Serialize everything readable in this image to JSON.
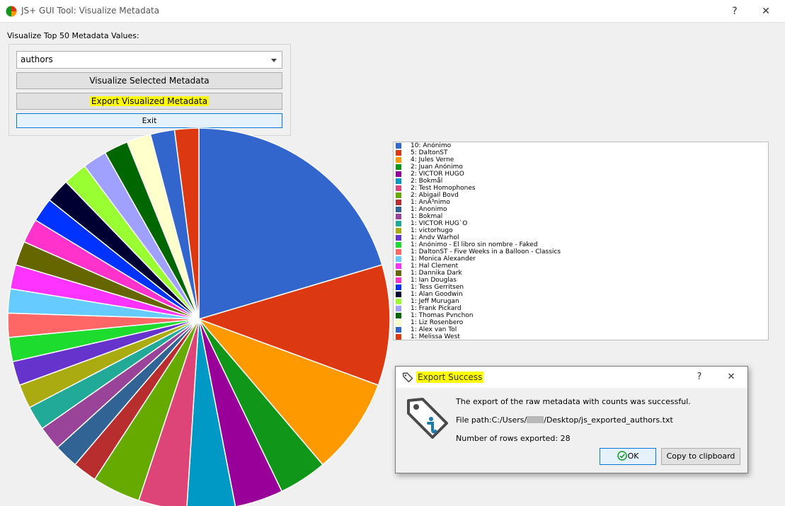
{
  "window": {
    "title": "JS+ GUI Tool: Visualize Metadata",
    "help_label": "?",
    "close_label": "✕"
  },
  "controls": {
    "section_label": "Visualize Top 50 Metadata Values:",
    "combo_value": "authors",
    "visualize_label": "Visualize Selected Metadata",
    "export_label": "Export Visualized Metadata",
    "exit_label": "Exit"
  },
  "chart_data": {
    "type": "pie",
    "categories": [
      "Anónimo",
      "DaltonST",
      "Jules Verne",
      "Juan Anónimo",
      "VICTOR HUGO",
      "Bokmål",
      "Test Homophones",
      "Abigail Bovd",
      "AnÃ³nimo",
      "Anonimo",
      "Bokmal",
      "VICTOR HUG`O",
      "victorhugo",
      "Andv Warhol",
      "Anónimo - El libro sin nombre - Faked",
      "DaltonST - Five Weeks in a Balloon - Classics",
      "Monica Alexander",
      "Hal Clement",
      "Dannika Dark",
      "Ian Douglas",
      "Tess Gerritsen",
      "Alan Goodwin",
      "Jeff Murugan",
      "Frank Pickard",
      "Thomas Pvnchon",
      "Liz Rosenbero",
      "Alex van Tol",
      "Melissa West"
    ],
    "values": [
      10,
      5,
      4,
      2,
      2,
      2,
      2,
      2,
      1,
      1,
      1,
      1,
      1,
      1,
      1,
      1,
      1,
      1,
      1,
      1,
      1,
      1,
      1,
      1,
      1,
      1,
      1,
      1
    ],
    "colors": [
      "#3366cc",
      "#dc3912",
      "#ff9900",
      "#109618",
      "#990099",
      "#0099c6",
      "#dd4477",
      "#66aa00",
      "#b82e2e",
      "#316395",
      "#994499",
      "#22aa99",
      "#aaaa11",
      "#6633cc",
      "#1edc2e",
      "#ff6666",
      "#66ccff",
      "#ff33ff",
      "#666600",
      "#ff33cc",
      "#0033ff",
      "#000033",
      "#99ff33",
      "#a0a0ff",
      "#006600",
      "#ffffcc",
      "#3366cc",
      "#dc3912"
    ],
    "legend": [
      "10: Anónimo",
      "5: DaltonST",
      "4: Jules Verne",
      "2: Juan Anónimo",
      "2: VICTOR HUGO",
      "2: Bokmål",
      "2: Test Homophones",
      "2: Abigail Bovd",
      "1: AnÃ³nimo",
      "1: Anonimo",
      "1: Bokmal",
      "1: VICTOR HUG`O",
      "1: victorhugo",
      "1: Andv Warhol",
      "1: Anónimo - El libro sin nombre - Faked",
      "1: DaltonST - Five Weeks in a Balloon - Classics",
      "1: Monica Alexander",
      "1: Hal Clement",
      "1: Dannika Dark",
      "1: Ian Douglas",
      "1: Tess Gerritsen",
      "1: Alan Goodwin",
      "1: Jeff Murugan",
      "1: Frank Pickard",
      "1: Thomas Pvnchon",
      "1: Liz Rosenbero",
      "1: Alex van Tol",
      "1: Melissa West"
    ],
    "legend_placement": "right"
  },
  "dialog": {
    "title": "Export Success",
    "help_label": "?",
    "close_label": "✕",
    "message": "The export of the raw metadata with counts was successful.",
    "path_prefix": "File path:C:/Users/",
    "path_suffix": "/Desktop/js_exported_authors.txt",
    "rows_text": "Number of rows exported: 28",
    "ok_label": "OK",
    "copy_label": "Copy to clipboard"
  }
}
